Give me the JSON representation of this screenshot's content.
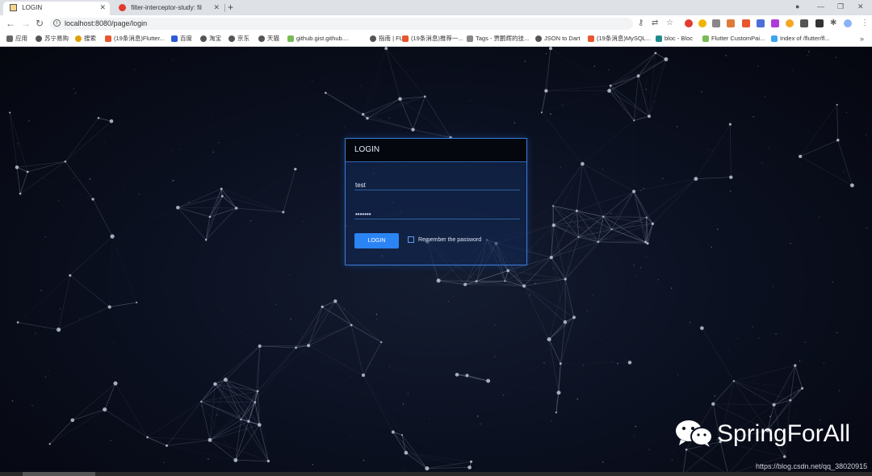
{
  "browser": {
    "tabs": [
      {
        "label": "LOGIN",
        "active": true,
        "icon": "login-page-icon"
      },
      {
        "label": "filter-interceptor-study: filter-in",
        "active": false,
        "icon": "red-site-icon"
      }
    ],
    "address": "localhost:8080/page/login",
    "bookmarks": [
      {
        "label": "应用",
        "icon": "apps-grid-icon"
      },
      {
        "label": "苏宁易购",
        "icon": "globe-icon"
      },
      {
        "label": "搜索",
        "icon": "search-icon"
      },
      {
        "label": "(19条消息)Flutter...",
        "icon": "csdn-icon"
      },
      {
        "label": "百度",
        "icon": "baidu-icon"
      },
      {
        "label": "淘宝",
        "icon": "globe-icon"
      },
      {
        "label": "京东",
        "icon": "globe-icon"
      },
      {
        "label": "天猫",
        "icon": "globe-icon"
      },
      {
        "label": "github.gist.github....",
        "icon": "bookmark-icon"
      },
      {
        "label": "指南 | FLUI",
        "icon": "globe-icon"
      },
      {
        "label": "(19条消息)推荐一...",
        "icon": "csdn-icon"
      },
      {
        "label": "Tags - 贾鹏辉的技...",
        "icon": "tag-icon"
      },
      {
        "label": "JSON to Dart",
        "icon": "globe-icon"
      },
      {
        "label": "(19条消息)MySQL...",
        "icon": "csdn-icon"
      },
      {
        "label": "bloc - Bloc",
        "icon": "bloc-icon"
      },
      {
        "label": "Flutter CustomPai...",
        "icon": "bookmark-icon"
      },
      {
        "label": "Index of /flutter/fl...",
        "icon": "flutter-icon"
      }
    ],
    "bookmarks_more": "»"
  },
  "login": {
    "title": "LOGIN",
    "username": "test",
    "password": "test123",
    "button": "LOGIN",
    "remember_label": "Remember the password",
    "remember_checked": false
  },
  "watermark": {
    "brand": "SpringForAll",
    "url": "https://blog.csdn.net/qq_38020915"
  },
  "colors": {
    "accent": "#2b84f3",
    "panel_border": "#3b7dd8",
    "background": "#0a0f1e"
  }
}
